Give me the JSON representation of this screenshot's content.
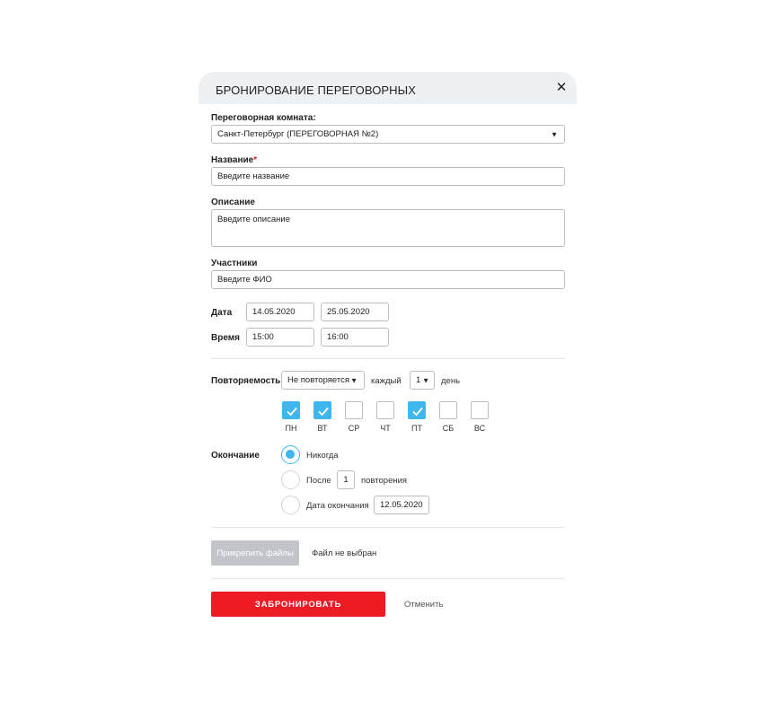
{
  "dialog": {
    "title": "БРОНИРОВАНИЕ ПЕРЕГОВОРНЫХ",
    "close_glyph": "✕"
  },
  "room": {
    "label": "Переговорная комната:",
    "value": "Санкт-Петербург (ПЕРЕГОВОРНАЯ №2)"
  },
  "name": {
    "label": "Название",
    "required_mark": "*",
    "placeholder": "Введите название"
  },
  "description": {
    "label": "Описание",
    "placeholder": "Введите описание"
  },
  "participants": {
    "label": "Участники",
    "placeholder": "Введите ФИО"
  },
  "date": {
    "label": "Дата",
    "start": "14.05.2020",
    "end": "25.05.2020"
  },
  "time": {
    "label": "Время",
    "start": "15:00",
    "end": "16:00"
  },
  "recurrence": {
    "label": "Повторяемость",
    "mode": "Не повторяется",
    "every_label": "каждый",
    "interval": "1",
    "unit": "день",
    "days": [
      {
        "label": "ПН",
        "checked": true
      },
      {
        "label": "ВТ",
        "checked": true
      },
      {
        "label": "СР",
        "checked": false
      },
      {
        "label": "ЧТ",
        "checked": false
      },
      {
        "label": "ПТ",
        "checked": true
      },
      {
        "label": "СБ",
        "checked": false
      },
      {
        "label": "ВС",
        "checked": false
      }
    ]
  },
  "ending": {
    "label": "Окончание",
    "never": "Никогда",
    "after_prefix": "После",
    "after_count": "1",
    "after_suffix": "повторения",
    "end_date_label": "Дата окончания",
    "end_date": "12.05.2020",
    "selected": "never"
  },
  "files": {
    "attach_label": "Прикрепить файлы",
    "status": "Файл не выбран"
  },
  "actions": {
    "book_label": "ЗАБРОНИРОВАТЬ",
    "cancel_label": "Отменить"
  },
  "colors": {
    "accent": "#3fb6ee",
    "primary_button": "#ed1c24",
    "disabled_button": "#c1c4c8",
    "header_bg": "#eef1f4"
  }
}
